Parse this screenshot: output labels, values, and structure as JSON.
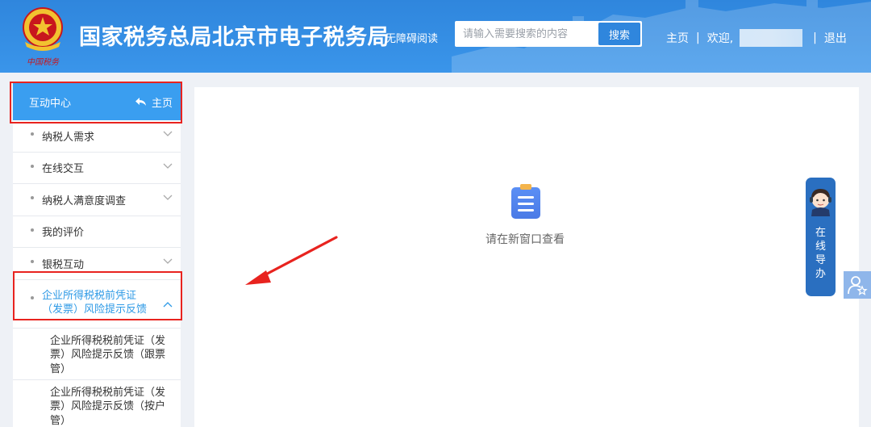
{
  "header": {
    "title": "国家税务总局北京市电子税务局",
    "accessible_label": "无障碍阅读",
    "search": {
      "placeholder": "请输入需要搜索的内容",
      "button_label": "搜索"
    },
    "nav": {
      "home": "主页",
      "welcome": "欢迎,",
      "logout": "退出",
      "separator": "|"
    },
    "brand_color": "#2f86dd"
  },
  "sidebar": {
    "title": "互动中心",
    "home_label": "主页",
    "items": [
      {
        "label": "纳税人需求",
        "expandable": true
      },
      {
        "label": "在线交互",
        "expandable": true
      },
      {
        "label": "纳税人满意度调查",
        "expandable": true
      },
      {
        "label": "我的评价",
        "expandable": false
      },
      {
        "label": "银税互动",
        "expandable": true
      }
    ],
    "active_item": {
      "label": "企业所得税税前凭证（发票）风险提示反馈",
      "expanded": true
    },
    "sub_items": [
      "企业所得税税前凭证（发票）风险提示反馈（跟票管）",
      "企业所得税税前凭证（发票）风险提示反馈（按户管）"
    ],
    "accent_color": "#3a9ef0",
    "highlight_color": "#e8231f"
  },
  "main": {
    "message": "请在新窗口查看"
  },
  "guide": {
    "chars": [
      "在",
      "线",
      "导",
      "办"
    ]
  }
}
